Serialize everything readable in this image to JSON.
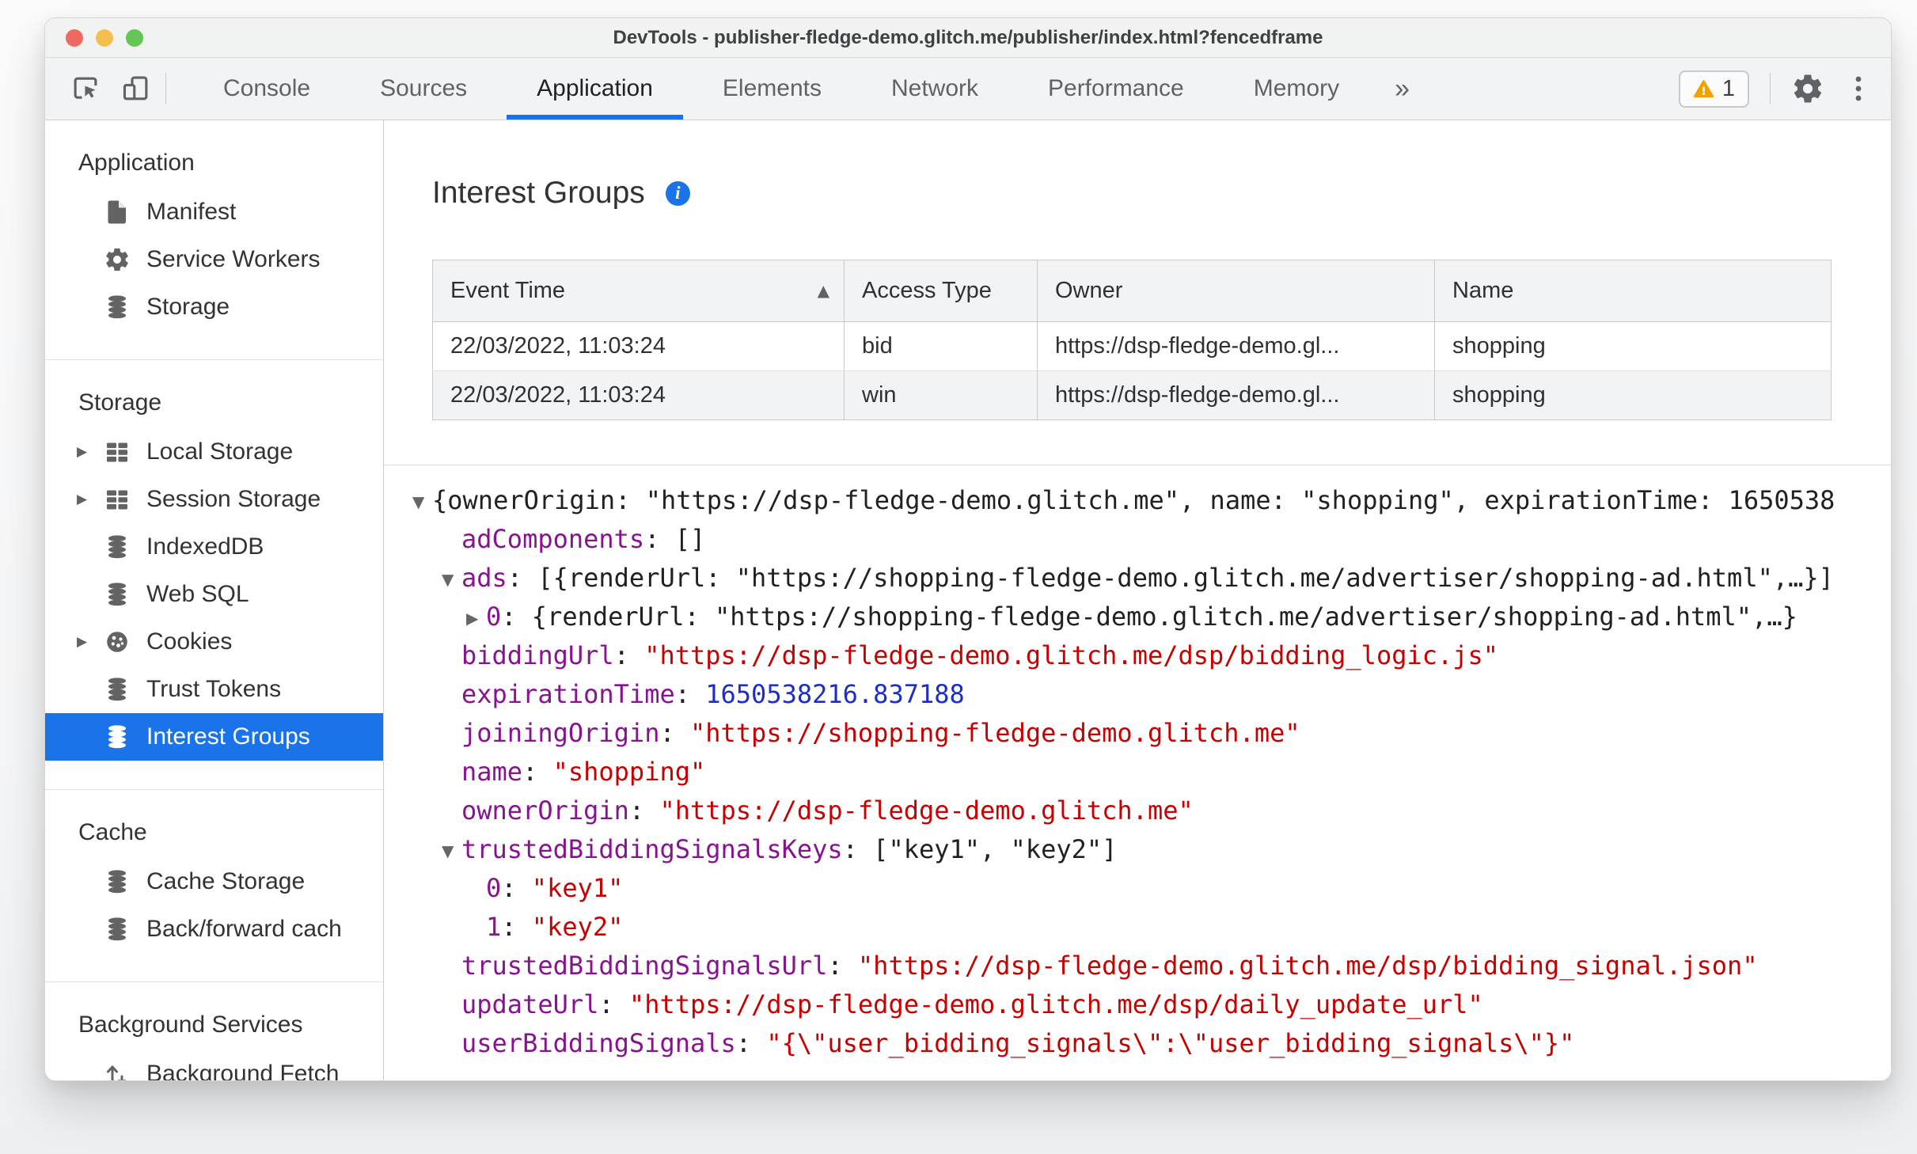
{
  "titlebar": {
    "title": "DevTools - publisher-fledge-demo.glitch.me/publisher/index.html?fencedframe",
    "traffic_lights": [
      "close-button",
      "minimize-button",
      "zoom-button"
    ]
  },
  "toolbar": {
    "left_icons": [
      "inspect-cursor-icon",
      "device-toolbar-icon"
    ],
    "tabs": [
      "Console",
      "Sources",
      "Application",
      "Elements",
      "Network",
      "Performance",
      "Memory"
    ],
    "selected_tab": "Application",
    "more_tabs_label": "»",
    "warning_count": "1",
    "right_icons": [
      "warning-icon",
      "gear-icon",
      "kebab-menu-icon"
    ]
  },
  "sidebar": {
    "sections": [
      {
        "header": "Application",
        "items": [
          {
            "label": "Manifest",
            "icon": "document-icon"
          },
          {
            "label": "Service Workers",
            "icon": "gear-icon"
          },
          {
            "label": "Storage",
            "icon": "database-icon"
          }
        ]
      },
      {
        "header": "Storage",
        "items": [
          {
            "label": "Local Storage",
            "icon": "table-icon",
            "expandable": true
          },
          {
            "label": "Session Storage",
            "icon": "table-icon",
            "expandable": true
          },
          {
            "label": "IndexedDB",
            "icon": "database-icon"
          },
          {
            "label": "Web SQL",
            "icon": "database-icon"
          },
          {
            "label": "Cookies",
            "icon": "cookie-icon",
            "expandable": true
          },
          {
            "label": "Trust Tokens",
            "icon": "database-icon"
          },
          {
            "label": "Interest Groups",
            "icon": "database-icon",
            "selected": true
          }
        ]
      },
      {
        "header": "Cache",
        "items": [
          {
            "label": "Cache Storage",
            "icon": "database-icon"
          },
          {
            "label": "Back/forward cach",
            "icon": "database-icon"
          }
        ]
      },
      {
        "header": "Background Services",
        "items": [
          {
            "label": "Background Fetch",
            "icon": "fetch-arrows-icon"
          }
        ]
      }
    ]
  },
  "main": {
    "title": "Interest Groups",
    "info_icon_glyph": "i",
    "table": {
      "columns": [
        "Event Time",
        "Access Type",
        "Owner",
        "Name"
      ],
      "sort": {
        "column": "Event Time",
        "direction": "asc",
        "glyph": "▲"
      },
      "rows": [
        [
          "22/03/2022, 11:03:24",
          "bid",
          "https://dsp-fledge-demo.gl...",
          "shopping"
        ],
        [
          "22/03/2022, 11:03:24",
          "win",
          "https://dsp-fledge-demo.gl...",
          "shopping"
        ]
      ]
    },
    "tree": {
      "rows": [
        {
          "indent": 0,
          "arrow": "down",
          "interactable": true,
          "segments": [
            {
              "c": "plain",
              "t": "{ownerOrigin: \"https://dsp-fledge-demo.glitch.me\", name: \"shopping\", expirationTime: 1650538"
            }
          ]
        },
        {
          "indent": 1,
          "arrow": null,
          "interactable": false,
          "segments": [
            {
              "c": "key",
              "t": "adComponents"
            },
            {
              "c": "plain",
              "t": ": []"
            }
          ]
        },
        {
          "indent": 1,
          "arrow": "down",
          "interactable": true,
          "segments": [
            {
              "c": "key",
              "t": "ads"
            },
            {
              "c": "plain",
              "t": ": [{renderUrl: \"https://shopping-fledge-demo.glitch.me/advertiser/shopping-ad.html\",…}]"
            }
          ]
        },
        {
          "indent": 2,
          "arrow": "right",
          "interactable": true,
          "segments": [
            {
              "c": "key",
              "t": "0"
            },
            {
              "c": "plain",
              "t": ": {renderUrl: \"https://shopping-fledge-demo.glitch.me/advertiser/shopping-ad.html\",…}"
            }
          ]
        },
        {
          "indent": 1,
          "arrow": null,
          "interactable": false,
          "segments": [
            {
              "c": "key",
              "t": "biddingUrl"
            },
            {
              "c": "plain",
              "t": ": "
            },
            {
              "c": "str",
              "t": "\"https://dsp-fledge-demo.glitch.me/dsp/bidding_logic.js\""
            }
          ]
        },
        {
          "indent": 1,
          "arrow": null,
          "interactable": false,
          "segments": [
            {
              "c": "key",
              "t": "expirationTime"
            },
            {
              "c": "plain",
              "t": ": "
            },
            {
              "c": "num",
              "t": "1650538216.837188"
            }
          ]
        },
        {
          "indent": 1,
          "arrow": null,
          "interactable": false,
          "segments": [
            {
              "c": "key",
              "t": "joiningOrigin"
            },
            {
              "c": "plain",
              "t": ": "
            },
            {
              "c": "str",
              "t": "\"https://shopping-fledge-demo.glitch.me\""
            }
          ]
        },
        {
          "indent": 1,
          "arrow": null,
          "interactable": false,
          "segments": [
            {
              "c": "key",
              "t": "name"
            },
            {
              "c": "plain",
              "t": ": "
            },
            {
              "c": "str",
              "t": "\"shopping\""
            }
          ]
        },
        {
          "indent": 1,
          "arrow": null,
          "interactable": false,
          "segments": [
            {
              "c": "key",
              "t": "ownerOrigin"
            },
            {
              "c": "plain",
              "t": ": "
            },
            {
              "c": "str",
              "t": "\"https://dsp-fledge-demo.glitch.me\""
            }
          ]
        },
        {
          "indent": 1,
          "arrow": "down",
          "interactable": true,
          "segments": [
            {
              "c": "key",
              "t": "trustedBiddingSignalsKeys"
            },
            {
              "c": "plain",
              "t": ": [\"key1\", \"key2\"]"
            }
          ]
        },
        {
          "indent": 2,
          "arrow": null,
          "interactable": false,
          "segments": [
            {
              "c": "key",
              "t": "0"
            },
            {
              "c": "plain",
              "t": ": "
            },
            {
              "c": "str",
              "t": "\"key1\""
            }
          ]
        },
        {
          "indent": 2,
          "arrow": null,
          "interactable": false,
          "segments": [
            {
              "c": "key",
              "t": "1"
            },
            {
              "c": "plain",
              "t": ": "
            },
            {
              "c": "str",
              "t": "\"key2\""
            }
          ]
        },
        {
          "indent": 1,
          "arrow": null,
          "interactable": false,
          "segments": [
            {
              "c": "key",
              "t": "trustedBiddingSignalsUrl"
            },
            {
              "c": "plain",
              "t": ": "
            },
            {
              "c": "str",
              "t": "\"https://dsp-fledge-demo.glitch.me/dsp/bidding_signal.json\""
            }
          ]
        },
        {
          "indent": 1,
          "arrow": null,
          "interactable": false,
          "segments": [
            {
              "c": "key",
              "t": "updateUrl"
            },
            {
              "c": "plain",
              "t": ": "
            },
            {
              "c": "str",
              "t": "\"https://dsp-fledge-demo.glitch.me/dsp/daily_update_url\""
            }
          ]
        },
        {
          "indent": 1,
          "arrow": null,
          "interactable": false,
          "segments": [
            {
              "c": "key",
              "t": "userBiddingSignals"
            },
            {
              "c": "plain",
              "t": ": "
            },
            {
              "c": "str",
              "t": "\"{\\\"user_bidding_signals\\\":\\\"user_bidding_signals\\\"}\""
            }
          ]
        }
      ]
    }
  },
  "colors": {
    "accent": "#1a73e8",
    "tree_key": "#881391",
    "tree_string": "#c80000",
    "tree_number": "#1c2ec8",
    "warning": "#f0a100",
    "traffic_red": "#ed6a5f",
    "traffic_yellow": "#f5bf4f",
    "traffic_green": "#62c554",
    "selected_tab_underline": "#1a73e8",
    "selected_sidebar_bg": "#1a73e8"
  }
}
